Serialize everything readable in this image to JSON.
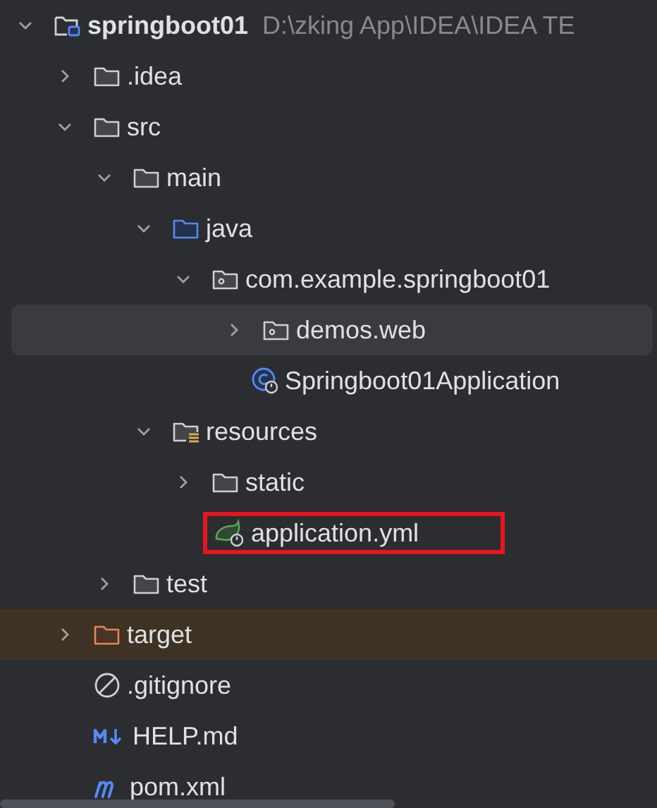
{
  "project_tree": [
    {
      "name": "springboot01",
      "kind": "project",
      "path": "D:\\zking App\\IDEA\\IDEA TE",
      "expanded": true,
      "selected": false,
      "children": [
        {
          "name": ".idea",
          "kind": "folder",
          "expanded": false,
          "selected": false
        },
        {
          "name": "src",
          "kind": "folder",
          "expanded": true,
          "selected": false,
          "children": [
            {
              "name": "main",
              "kind": "folder",
              "expanded": true,
              "selected": false,
              "children": [
                {
                  "name": "java",
                  "kind": "source-folder",
                  "expanded": true,
                  "selected": false,
                  "children": [
                    {
                      "name": "com.example.springboot01",
                      "kind": "package",
                      "expanded": true,
                      "selected": false,
                      "children": [
                        {
                          "name": "demos.web",
                          "kind": "package",
                          "expanded": false,
                          "selected": true
                        },
                        {
                          "name": "Springboot01Application",
                          "kind": "class",
                          "selected": false
                        }
                      ]
                    }
                  ]
                },
                {
                  "name": "resources",
                  "kind": "resources-folder",
                  "expanded": true,
                  "selected": false,
                  "children": [
                    {
                      "name": "static",
                      "kind": "folder",
                      "expanded": false,
                      "selected": false
                    },
                    {
                      "name": "application.yml",
                      "kind": "spring-config",
                      "selected": false,
                      "annotated": true
                    }
                  ]
                }
              ]
            },
            {
              "name": "test",
              "kind": "folder",
              "expanded": false,
              "selected": false
            }
          ]
        },
        {
          "name": "target",
          "kind": "excluded-folder",
          "expanded": false,
          "selected": false
        },
        {
          "name": ".gitignore",
          "kind": "gitignore",
          "selected": false
        },
        {
          "name": "HELP.md",
          "kind": "markdown",
          "selected": false
        },
        {
          "name": "pom.xml",
          "kind": "maven",
          "selected": false
        }
      ]
    }
  ]
}
